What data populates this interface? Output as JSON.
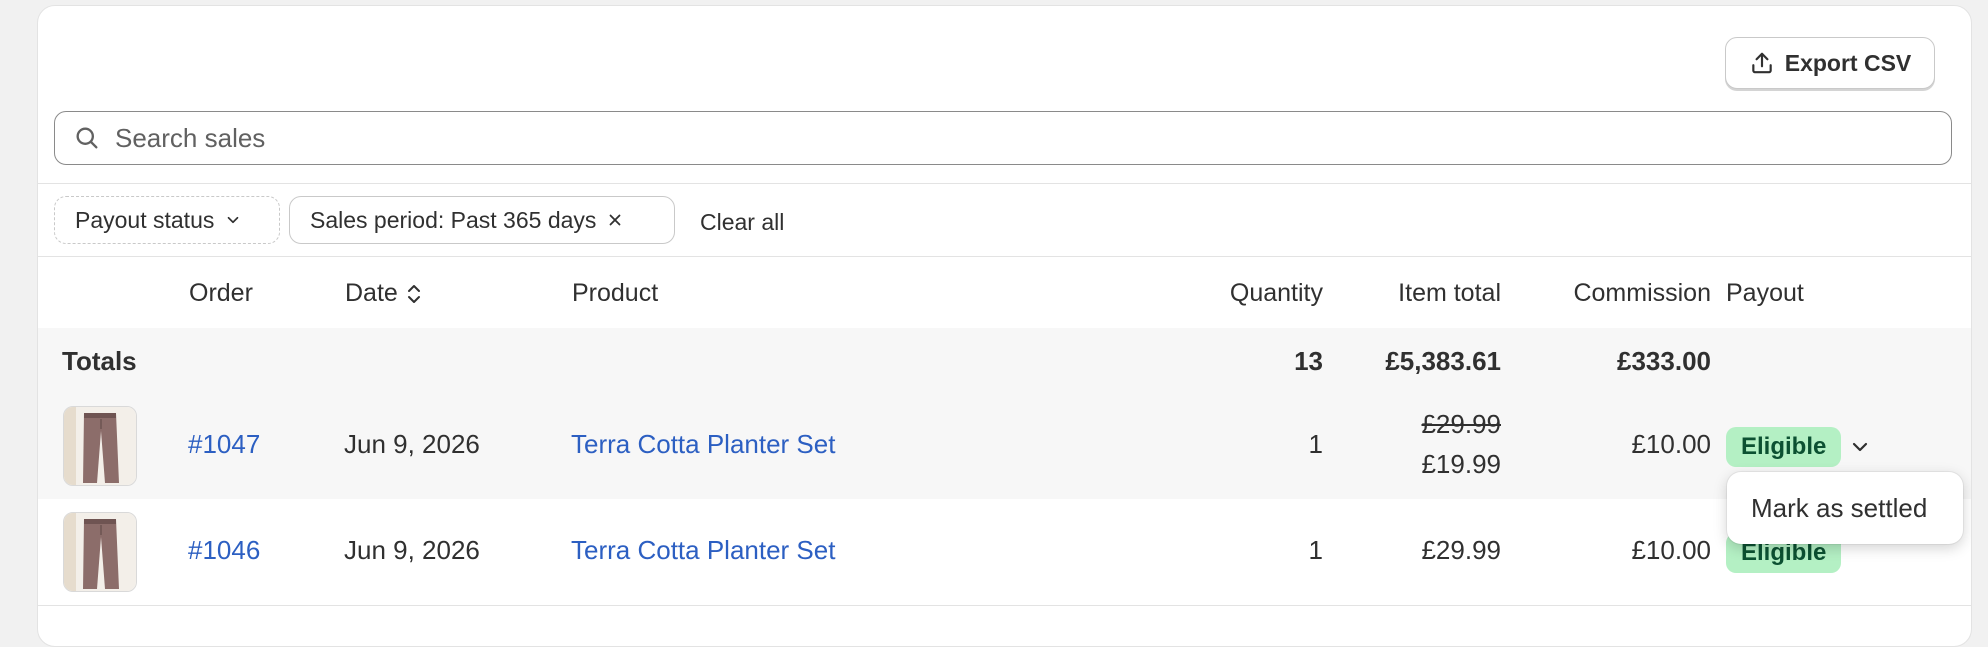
{
  "toolbar": {
    "export_label": "Export CSV"
  },
  "search": {
    "placeholder": "Search sales"
  },
  "filters": {
    "payout_status_label": "Payout status",
    "sales_period_label": "Sales period: Past 365 days",
    "clear_all_label": "Clear all"
  },
  "table": {
    "columns": {
      "order": "Order",
      "date": "Date",
      "product": "Product",
      "quantity": "Quantity",
      "item_total": "Item total",
      "commission": "Commission",
      "payout": "Payout"
    },
    "totals": {
      "label": "Totals",
      "quantity": "13",
      "item_total": "£5,383.61",
      "commission": "£333.00"
    },
    "rows": [
      {
        "order": "#1047",
        "date": "Jun 9, 2026",
        "product": "Terra Cotta Planter Set",
        "quantity": "1",
        "original_price": "£29.99",
        "item_total": "£19.99",
        "commission": "£10.00",
        "payout": "Eligible"
      },
      {
        "order": "#1046",
        "date": "Jun 9, 2026",
        "product": "Terra Cotta Planter Set",
        "quantity": "1",
        "item_total": "£29.99",
        "commission": "£10.00",
        "payout": "Eligible"
      }
    ]
  },
  "popover": {
    "mark_settled_label": "Mark as settled"
  },
  "icons": {
    "export": "upload-icon",
    "search": "search-icon",
    "chevron": "chevron-down-icon",
    "sort": "sort-icon",
    "remove": "close-icon"
  },
  "colors": {
    "link": "#2c5fc2",
    "badge_bg": "#b4f0c4",
    "badge_text": "#0c5132"
  }
}
